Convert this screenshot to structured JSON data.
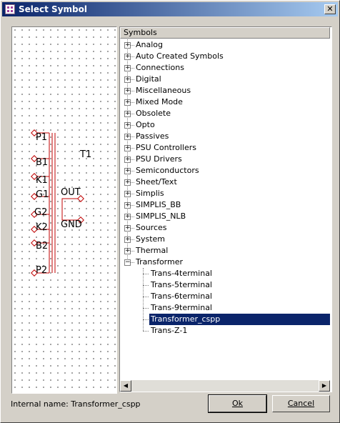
{
  "window": {
    "title": "Select Symbol"
  },
  "symbol_preview": {
    "ref_label": "T1",
    "pins_left": [
      "P1",
      "B1",
      "K1",
      "G1",
      "G2",
      "K2",
      "B2",
      "P2"
    ],
    "pins_right": [
      "OUT",
      "GND"
    ],
    "wire_color": "#c00000"
  },
  "tree": {
    "header": "Symbols",
    "categories": [
      "Analog",
      "Auto Created Symbols",
      "Connections",
      "Digital",
      "Miscellaneous",
      "Mixed Mode",
      "Obsolete",
      "Opto",
      "Passives",
      "PSU Controllers",
      "PSU Drivers",
      "Semiconductors",
      "Sheet/Text",
      "Simplis",
      "SIMPLIS_BB",
      "SIMPLIS_NLB",
      "Sources",
      "System",
      "Thermal",
      "Transformer"
    ],
    "expanded": "Transformer",
    "children": [
      "Trans-4terminal",
      "Trans-5terminal",
      "Trans-6terminal",
      "Trans-9terminal",
      "Transformer_cspp",
      "Trans-Z-1"
    ],
    "selected": "Transformer_cspp"
  },
  "status": {
    "internal_name": "Internal name: Transformer_cspp"
  },
  "buttons": {
    "ok_label": "Ok",
    "cancel_label": "Cancel"
  },
  "colors": {
    "selection": "#0a246a",
    "title_start": "#0a246a",
    "title_end": "#a6caf0"
  }
}
